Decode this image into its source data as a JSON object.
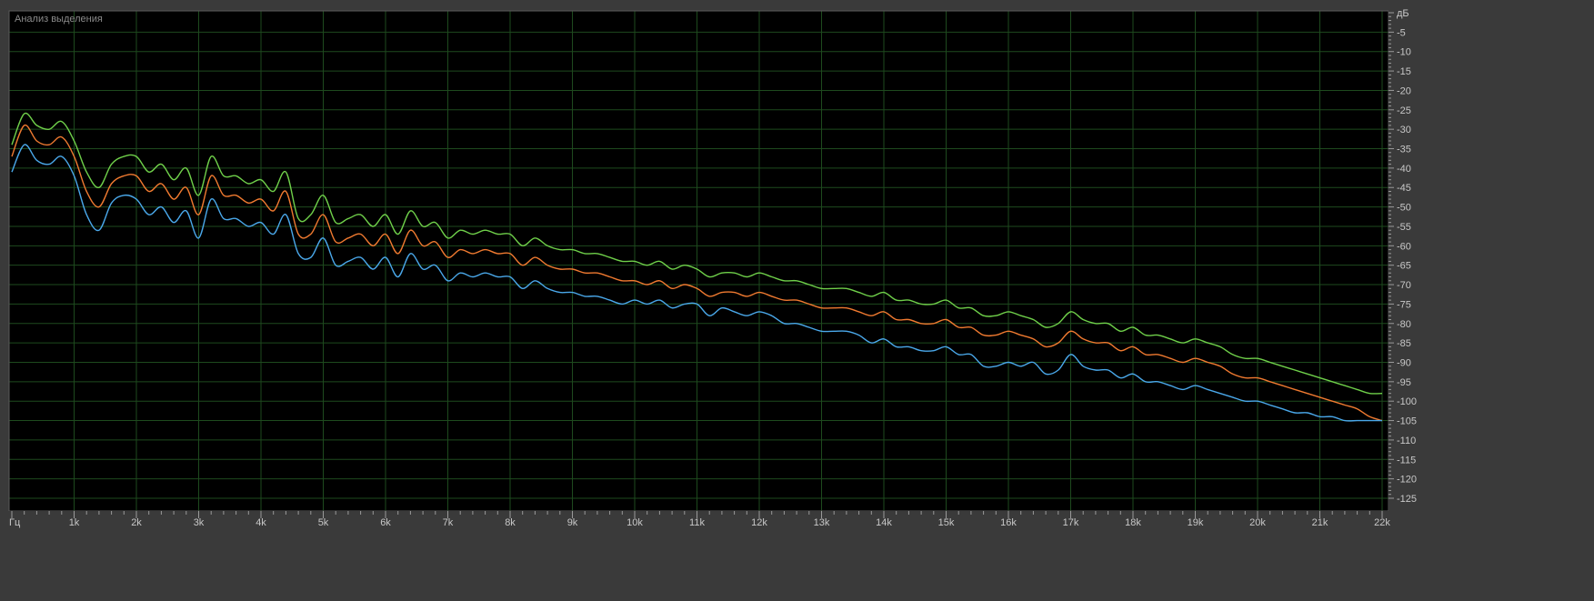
{
  "panel": {
    "title": "Анализ выделения"
  },
  "chart_data": {
    "type": "line",
    "title": "",
    "xlabel": "",
    "ylabel": "",
    "x_unit_label": "Гц",
    "y_unit_label": "дБ",
    "xlim": [
      0,
      22050
    ],
    "ylim": [
      -130,
      0
    ],
    "grid": true,
    "x_ticks": [
      {
        "value": 0,
        "label": "Гц"
      },
      {
        "value": 1000,
        "label": "1k"
      },
      {
        "value": 2000,
        "label": "2k"
      },
      {
        "value": 3000,
        "label": "3k"
      },
      {
        "value": 4000,
        "label": "4k"
      },
      {
        "value": 5000,
        "label": "5k"
      },
      {
        "value": 6000,
        "label": "6k"
      },
      {
        "value": 7000,
        "label": "7k"
      },
      {
        "value": 8000,
        "label": "8k"
      },
      {
        "value": 9000,
        "label": "9k"
      },
      {
        "value": 10000,
        "label": "10k"
      },
      {
        "value": 11000,
        "label": "11k"
      },
      {
        "value": 12000,
        "label": "12k"
      },
      {
        "value": 13000,
        "label": "13k"
      },
      {
        "value": 14000,
        "label": "14k"
      },
      {
        "value": 15000,
        "label": "15k"
      },
      {
        "value": 16000,
        "label": "16k"
      },
      {
        "value": 17000,
        "label": "17k"
      },
      {
        "value": 18000,
        "label": "18k"
      },
      {
        "value": 19000,
        "label": "19k"
      },
      {
        "value": 20000,
        "label": "20k"
      },
      {
        "value": 21000,
        "label": "21k"
      },
      {
        "value": 22000,
        "label": "22k"
      }
    ],
    "y_ticks": [
      {
        "value": 0,
        "label": "дБ"
      },
      {
        "value": -5,
        "label": "-5"
      },
      {
        "value": -10,
        "label": "-10"
      },
      {
        "value": -15,
        "label": "-15"
      },
      {
        "value": -20,
        "label": "-20"
      },
      {
        "value": -25,
        "label": "-25"
      },
      {
        "value": -30,
        "label": "-30"
      },
      {
        "value": -35,
        "label": "-35"
      },
      {
        "value": -40,
        "label": "-40"
      },
      {
        "value": -45,
        "label": "-45"
      },
      {
        "value": -50,
        "label": "-50"
      },
      {
        "value": -55,
        "label": "-55"
      },
      {
        "value": -60,
        "label": "-60"
      },
      {
        "value": -65,
        "label": "-65"
      },
      {
        "value": -70,
        "label": "-70"
      },
      {
        "value": -75,
        "label": "-75"
      },
      {
        "value": -80,
        "label": "-80"
      },
      {
        "value": -85,
        "label": "-85"
      },
      {
        "value": -90,
        "label": "-90"
      },
      {
        "value": -95,
        "label": "-95"
      },
      {
        "value": -100,
        "label": "-100"
      },
      {
        "value": -105,
        "label": "-105"
      },
      {
        "value": -110,
        "label": "-110"
      },
      {
        "value": -115,
        "label": "-115"
      },
      {
        "value": -120,
        "label": "-120"
      },
      {
        "value": -125,
        "label": "-125"
      }
    ],
    "colors": {
      "background": "#000000",
      "grid": "#1e4a1e",
      "axis_bg": "#3a3a3a",
      "tick_text": "#c8c8c8"
    },
    "series": [
      {
        "color": "#6fd04a",
        "x": [
          0,
          200,
          400,
          600,
          800,
          1000,
          1200,
          1400,
          1600,
          1800,
          2000,
          2200,
          2400,
          2600,
          2800,
          3000,
          3200,
          3400,
          3600,
          3800,
          4000,
          4200,
          4400,
          4600,
          4800,
          5000,
          5200,
          5400,
          5600,
          5800,
          6000,
          6200,
          6400,
          6600,
          6800,
          7000,
          7200,
          7400,
          7600,
          7800,
          8000,
          8200,
          8400,
          8600,
          8800,
          9000,
          9200,
          9400,
          9600,
          9800,
          10000,
          10200,
          10400,
          10600,
          10800,
          11000,
          11200,
          11400,
          11600,
          11800,
          12000,
          12200,
          12400,
          12600,
          12800,
          13000,
          13200,
          13400,
          13600,
          13800,
          14000,
          14200,
          14400,
          14600,
          14800,
          15000,
          15200,
          15400,
          15600,
          15800,
          16000,
          16200,
          16400,
          16600,
          16800,
          17000,
          17200,
          17400,
          17600,
          17800,
          18000,
          18200,
          18400,
          18600,
          18800,
          19000,
          19200,
          19400,
          19600,
          19800,
          20000,
          20200,
          20400,
          20600,
          20800,
          21000,
          21200,
          21400,
          21600,
          21800,
          22000
        ],
        "values": [
          -34,
          -26,
          -29,
          -30,
          -28,
          -33,
          -41,
          -45,
          -39,
          -37,
          -37,
          -41,
          -39,
          -43,
          -40,
          -47,
          -37,
          -42,
          -42,
          -44,
          -43,
          -46,
          -41,
          -53,
          -52,
          -47,
          -54,
          -53,
          -52,
          -55,
          -52,
          -57,
          -51,
          -55,
          -54,
          -58,
          -56,
          -57,
          -56,
          -57,
          -57,
          -60,
          -58,
          -60,
          -61,
          -61,
          -62,
          -62,
          -63,
          -64,
          -64,
          -65,
          -64,
          -66,
          -65,
          -66,
          -68,
          -67,
          -67,
          -68,
          -67,
          -68,
          -69,
          -69,
          -70,
          -71,
          -71,
          -71,
          -72,
          -73,
          -72,
          -74,
          -74,
          -75,
          -75,
          -74,
          -76,
          -76,
          -78,
          -78,
          -77,
          -78,
          -79,
          -81,
          -80,
          -77,
          -79,
          -80,
          -80,
          -82,
          -81,
          -83,
          -83,
          -84,
          -85,
          -84,
          -85,
          -86,
          -88,
          -89,
          -89,
          -90,
          -91,
          -92,
          -93,
          -94,
          -95,
          -96,
          -97,
          -98,
          -98
        ]
      },
      {
        "color": "#f07a30",
        "x": [
          0,
          200,
          400,
          600,
          800,
          1000,
          1200,
          1400,
          1600,
          1800,
          2000,
          2200,
          2400,
          2600,
          2800,
          3000,
          3200,
          3400,
          3600,
          3800,
          4000,
          4200,
          4400,
          4600,
          4800,
          5000,
          5200,
          5400,
          5600,
          5800,
          6000,
          6200,
          6400,
          6600,
          6800,
          7000,
          7200,
          7400,
          7600,
          7800,
          8000,
          8200,
          8400,
          8600,
          8800,
          9000,
          9200,
          9400,
          9600,
          9800,
          10000,
          10200,
          10400,
          10600,
          10800,
          11000,
          11200,
          11400,
          11600,
          11800,
          12000,
          12200,
          12400,
          12600,
          12800,
          13000,
          13200,
          13400,
          13600,
          13800,
          14000,
          14200,
          14400,
          14600,
          14800,
          15000,
          15200,
          15400,
          15600,
          15800,
          16000,
          16200,
          16400,
          16600,
          16800,
          17000,
          17200,
          17400,
          17600,
          17800,
          18000,
          18200,
          18400,
          18600,
          18800,
          19000,
          19200,
          19400,
          19600,
          19800,
          20000,
          20200,
          20400,
          20600,
          20800,
          21000,
          21200,
          21400,
          21600,
          21800,
          22000
        ],
        "values": [
          -37,
          -29,
          -33,
          -34,
          -32,
          -37,
          -46,
          -50,
          -44,
          -42,
          -42,
          -46,
          -44,
          -48,
          -45,
          -52,
          -42,
          -47,
          -47,
          -49,
          -48,
          -51,
          -46,
          -57,
          -57,
          -52,
          -59,
          -58,
          -57,
          -60,
          -57,
          -62,
          -56,
          -60,
          -59,
          -63,
          -61,
          -62,
          -61,
          -62,
          -62,
          -65,
          -63,
          -65,
          -66,
          -66,
          -67,
          -67,
          -68,
          -69,
          -69,
          -70,
          -69,
          -71,
          -70,
          -71,
          -73,
          -72,
          -72,
          -73,
          -72,
          -73,
          -74,
          -74,
          -75,
          -76,
          -76,
          -76,
          -77,
          -78,
          -77,
          -79,
          -79,
          -80,
          -80,
          -79,
          -81,
          -81,
          -83,
          -83,
          -82,
          -83,
          -84,
          -86,
          -85,
          -82,
          -84,
          -85,
          -85,
          -87,
          -86,
          -88,
          -88,
          -89,
          -90,
          -89,
          -90,
          -91,
          -93,
          -94,
          -94,
          -95,
          -96,
          -97,
          -98,
          -99,
          -100,
          -101,
          -102,
          -104,
          -105
        ]
      },
      {
        "color": "#4aa8ea",
        "x": [
          0,
          200,
          400,
          600,
          800,
          1000,
          1200,
          1400,
          1600,
          1800,
          2000,
          2200,
          2400,
          2600,
          2800,
          3000,
          3200,
          3400,
          3600,
          3800,
          4000,
          4200,
          4400,
          4600,
          4800,
          5000,
          5200,
          5400,
          5600,
          5800,
          6000,
          6200,
          6400,
          6600,
          6800,
          7000,
          7200,
          7400,
          7600,
          7800,
          8000,
          8200,
          8400,
          8600,
          8800,
          9000,
          9200,
          9400,
          9600,
          9800,
          10000,
          10200,
          10400,
          10600,
          10800,
          11000,
          11200,
          11400,
          11600,
          11800,
          12000,
          12200,
          12400,
          12600,
          12800,
          13000,
          13200,
          13400,
          13600,
          13800,
          14000,
          14200,
          14400,
          14600,
          14800,
          15000,
          15200,
          15400,
          15600,
          15800,
          16000,
          16200,
          16400,
          16600,
          16800,
          17000,
          17200,
          17400,
          17600,
          17800,
          18000,
          18200,
          18400,
          18600,
          18800,
          19000,
          19200,
          19400,
          19600,
          19800,
          20000,
          20200,
          20400,
          20600,
          20800,
          21000,
          21200,
          21400,
          21600,
          21800,
          22000
        ],
        "values": [
          -41,
          -34,
          -38,
          -39,
          -37,
          -42,
          -52,
          -56,
          -49,
          -47,
          -48,
          -52,
          -50,
          -54,
          -51,
          -58,
          -48,
          -53,
          -53,
          -55,
          -54,
          -57,
          -52,
          -62,
          -63,
          -58,
          -65,
          -64,
          -63,
          -66,
          -63,
          -68,
          -62,
          -66,
          -65,
          -69,
          -67,
          -68,
          -67,
          -68,
          -68,
          -71,
          -69,
          -71,
          -72,
          -72,
          -73,
          -73,
          -74,
          -75,
          -74,
          -75,
          -74,
          -76,
          -75,
          -75,
          -78,
          -76,
          -77,
          -78,
          -77,
          -78,
          -80,
          -80,
          -81,
          -82,
          -82,
          -82,
          -83,
          -85,
          -84,
          -86,
          -86,
          -87,
          -87,
          -86,
          -88,
          -88,
          -91,
          -91,
          -90,
          -91,
          -90,
          -93,
          -92,
          -88,
          -91,
          -92,
          -92,
          -94,
          -93,
          -95,
          -95,
          -96,
          -97,
          -96,
          -97,
          -98,
          -99,
          -100,
          -100,
          -101,
          -102,
          -103,
          -103,
          -104,
          -104,
          -105,
          -105,
          -105,
          -105
        ]
      }
    ]
  }
}
